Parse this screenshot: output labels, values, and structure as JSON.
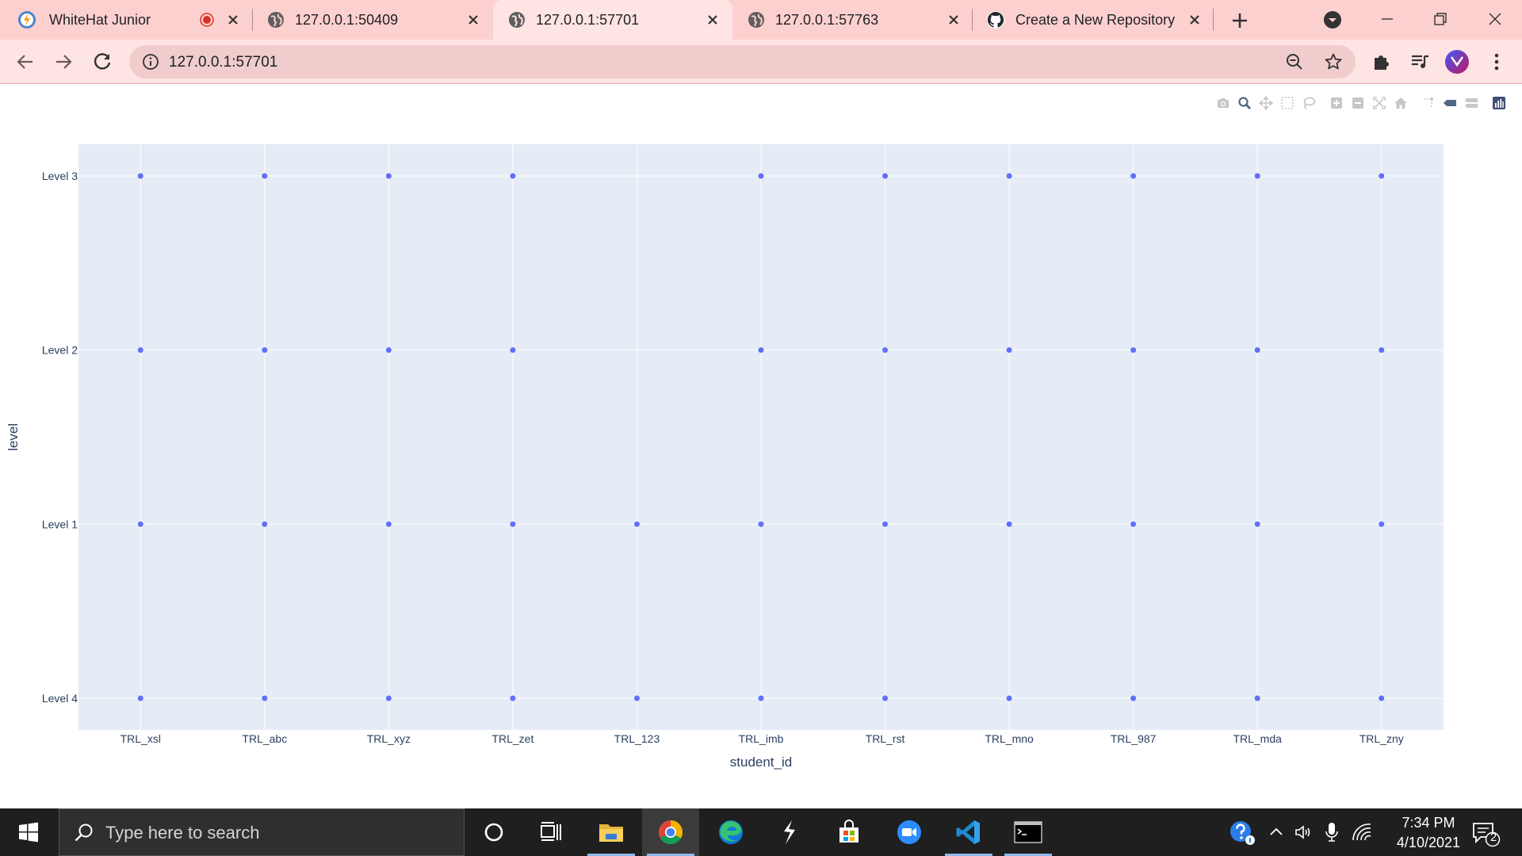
{
  "browser": {
    "tabs": [
      {
        "title": "WhiteHat Junior",
        "active": false,
        "recording": true
      },
      {
        "title": "127.0.0.1:50409",
        "active": false
      },
      {
        "title": "127.0.0.1:57701",
        "active": true
      },
      {
        "title": "127.0.0.1:57763",
        "active": false
      },
      {
        "title": "Create a New Repository",
        "active": false
      }
    ],
    "address": "127.0.0.1:57701",
    "colors": {
      "tabstrip": "#fdd0d0",
      "toolbar": "#ffe4e4",
      "omnibox": "#f0cccc"
    }
  },
  "modebar": {
    "icons": [
      "camera-icon",
      "zoom-icon",
      "pan-icon",
      "box-select-icon",
      "lasso-select-icon",
      "zoom-in-icon",
      "zoom-out-icon",
      "autoscale-icon",
      "reset-axes-icon",
      "spike-lines-icon",
      "hover-closest-icon",
      "hover-compare-icon",
      "plotly-logo-icon"
    ]
  },
  "chart_data": {
    "type": "scatter",
    "title": "",
    "xlabel": "student_id",
    "ylabel": "level",
    "categories": [
      "TRL_xsl",
      "TRL_abc",
      "TRL_xyz",
      "TRL_zet",
      "TRL_123",
      "TRL_imb",
      "TRL_rst",
      "TRL_mno",
      "TRL_987",
      "TRL_mda",
      "TRL_zny"
    ],
    "y_categories": [
      "Level 4",
      "Level 1",
      "Level 2",
      "Level 3"
    ],
    "points": [
      {
        "x": "TRL_xsl",
        "y": "Level 3"
      },
      {
        "x": "TRL_xsl",
        "y": "Level 2"
      },
      {
        "x": "TRL_xsl",
        "y": "Level 1"
      },
      {
        "x": "TRL_xsl",
        "y": "Level 4"
      },
      {
        "x": "TRL_abc",
        "y": "Level 3"
      },
      {
        "x": "TRL_abc",
        "y": "Level 2"
      },
      {
        "x": "TRL_abc",
        "y": "Level 1"
      },
      {
        "x": "TRL_abc",
        "y": "Level 4"
      },
      {
        "x": "TRL_xyz",
        "y": "Level 3"
      },
      {
        "x": "TRL_xyz",
        "y": "Level 2"
      },
      {
        "x": "TRL_xyz",
        "y": "Level 1"
      },
      {
        "x": "TRL_xyz",
        "y": "Level 4"
      },
      {
        "x": "TRL_zet",
        "y": "Level 3"
      },
      {
        "x": "TRL_zet",
        "y": "Level 2"
      },
      {
        "x": "TRL_zet",
        "y": "Level 1"
      },
      {
        "x": "TRL_zet",
        "y": "Level 4"
      },
      {
        "x": "TRL_123",
        "y": "Level 1"
      },
      {
        "x": "TRL_123",
        "y": "Level 4"
      },
      {
        "x": "TRL_imb",
        "y": "Level 3"
      },
      {
        "x": "TRL_imb",
        "y": "Level 2"
      },
      {
        "x": "TRL_imb",
        "y": "Level 1"
      },
      {
        "x": "TRL_imb",
        "y": "Level 4"
      },
      {
        "x": "TRL_rst",
        "y": "Level 3"
      },
      {
        "x": "TRL_rst",
        "y": "Level 2"
      },
      {
        "x": "TRL_rst",
        "y": "Level 1"
      },
      {
        "x": "TRL_rst",
        "y": "Level 4"
      },
      {
        "x": "TRL_mno",
        "y": "Level 3"
      },
      {
        "x": "TRL_mno",
        "y": "Level 2"
      },
      {
        "x": "TRL_mno",
        "y": "Level 1"
      },
      {
        "x": "TRL_mno",
        "y": "Level 4"
      },
      {
        "x": "TRL_987",
        "y": "Level 3"
      },
      {
        "x": "TRL_987",
        "y": "Level 2"
      },
      {
        "x": "TRL_987",
        "y": "Level 1"
      },
      {
        "x": "TRL_987",
        "y": "Level 4"
      },
      {
        "x": "TRL_mda",
        "y": "Level 3"
      },
      {
        "x": "TRL_mda",
        "y": "Level 2"
      },
      {
        "x": "TRL_mda",
        "y": "Level 1"
      },
      {
        "x": "TRL_mda",
        "y": "Level 4"
      },
      {
        "x": "TRL_zny",
        "y": "Level 3"
      },
      {
        "x": "TRL_zny",
        "y": "Level 2"
      },
      {
        "x": "TRL_zny",
        "y": "Level 1"
      },
      {
        "x": "TRL_zny",
        "y": "Level 4"
      }
    ],
    "grid": true,
    "colors": {
      "marker": "#636efa",
      "plot_bg": "#e5ecf6",
      "grid": "#ffffff",
      "text": "#2a3f5f"
    }
  },
  "taskbar": {
    "search_placeholder": "Type here to search",
    "apps": [
      "cortana-icon",
      "task-view-icon",
      "file-explorer-icon",
      "chrome-icon",
      "edge-icon",
      "sublime-icon",
      "store-icon",
      "zoom-icon",
      "vscode-icon",
      "terminal-icon"
    ],
    "time": "7:34 PM",
    "date": "4/10/2021",
    "notification_count": "2"
  }
}
